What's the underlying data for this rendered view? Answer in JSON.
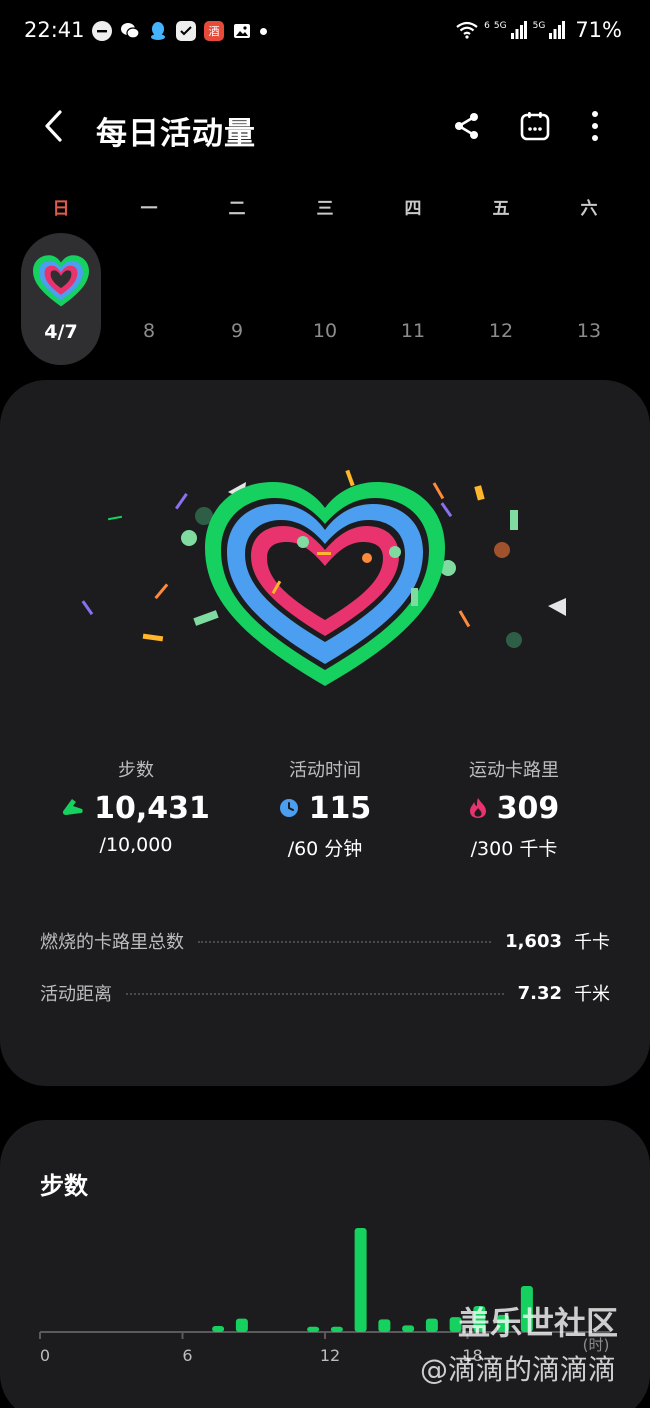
{
  "status_bar": {
    "time": "22:41",
    "notification_icons": [
      "dnd-icon",
      "wechat-icon",
      "qq-icon",
      "checklist-icon",
      "app-badge-icon",
      "gallery-icon",
      "more-dot-icon"
    ],
    "app_badge_text": "酒",
    "network_labels": [
      "6",
      "5G",
      "5G"
    ],
    "battery": "71%"
  },
  "header": {
    "title": "每日活动量",
    "back_icon": "chevron-left-icon",
    "actions": [
      "share-icon",
      "calendar-icon",
      "more-vert-icon"
    ]
  },
  "week": {
    "days": [
      "日",
      "一",
      "二",
      "三",
      "四",
      "五",
      "六"
    ],
    "dates": [
      "4/7",
      "8",
      "9",
      "10",
      "11",
      "12",
      "13"
    ],
    "selected_index": 0,
    "sunday_color": "#e25a4d"
  },
  "rings_colors": {
    "steps": "#16d05f",
    "active_time": "#4b9ef0",
    "calories": "#e8336f"
  },
  "summary": {
    "metrics": [
      {
        "label": "步数",
        "icon": "shoe-icon",
        "icon_color": "#16d05f",
        "value": "10,431",
        "goal": "/10,000"
      },
      {
        "label": "活动时间",
        "icon": "clock-icon",
        "icon_color": "#4b9ef0",
        "value": "115",
        "goal": "/60 分钟"
      },
      {
        "label": "运动卡路里",
        "icon": "flame-icon",
        "icon_color": "#e8336f",
        "value": "309",
        "goal": "/300 千卡"
      }
    ],
    "details": [
      {
        "label": "燃烧的卡路里总数",
        "value": "1,603",
        "unit": "千卡"
      },
      {
        "label": "活动距离",
        "value": "7.32",
        "unit": "千米"
      }
    ]
  },
  "steps_card": {
    "title": "步数",
    "chart_data": {
      "type": "bar",
      "title": "步数",
      "x_ticks": [
        "0",
        "6",
        "12",
        "18"
      ],
      "x_unit_label": "(时)",
      "x": [
        7,
        8,
        11,
        12,
        13,
        14,
        15,
        16,
        17,
        18,
        19,
        20
      ],
      "values": [
        80,
        180,
        70,
        70,
        1400,
        170,
        90,
        180,
        200,
        350,
        230,
        620
      ],
      "color": "#16d05f",
      "xlim": [
        0,
        24
      ],
      "ylim": [
        0,
        1400
      ],
      "grid": false
    }
  },
  "watermark": {
    "line1": "盖乐世社区",
    "line2": "@滴滴的滴滴滴"
  }
}
